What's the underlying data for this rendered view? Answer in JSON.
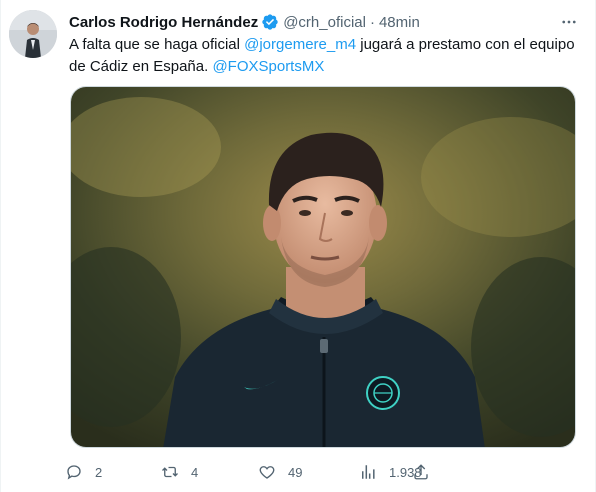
{
  "author": {
    "name": "Carlos Rodrigo Hernández",
    "handle": "@crh_oficial",
    "separator": "·",
    "time": "48min"
  },
  "tweet": {
    "text_part1": "A falta que se haga oficial ",
    "mention1": "@jorgemere_m4",
    "text_part2": " jugará a prestamo con el equipo de Cádiz en España. ",
    "mention2": "@FOXSportsMX"
  },
  "actions": {
    "replies": "2",
    "retweets": "4",
    "likes": "49",
    "views": "1.938"
  },
  "colors": {
    "accent": "#1d9bf0",
    "secondary_text": "#536471",
    "primary_text": "#0f1419",
    "nike_swoosh": "#3fd1c4",
    "jacket": "#1a2732"
  },
  "icons": [
    "verified-badge-icon",
    "more-options-icon",
    "reply-icon",
    "retweet-icon",
    "like-icon",
    "views-icon",
    "share-icon"
  ]
}
